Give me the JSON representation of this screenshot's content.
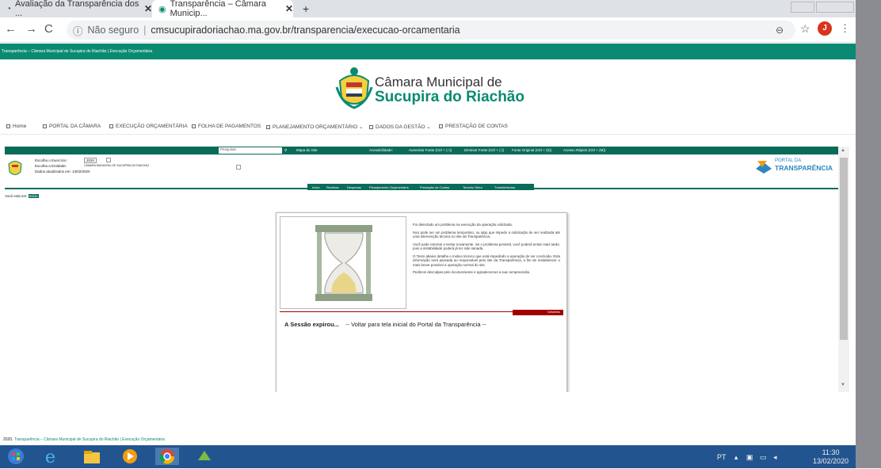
{
  "browser": {
    "tabs": [
      {
        "title": "Avaliação da Transparência dos ...",
        "close": "✕"
      },
      {
        "title": "Transparência – Câmara Municip...",
        "close": "✕"
      }
    ],
    "new_tab": "+",
    "security_label": "Não seguro",
    "url": "cmsucupiradoriachao.ma.gov.br/transparencia/execucao-orcamentaria",
    "profile_initial": "J"
  },
  "site": {
    "top_bar_text": "Transparência – Câmara Municipal de Sucupira do Riachão | Execução Orçamentária",
    "logo_line1": "Câmara Municipal de",
    "logo_line2": "Sucupira do Riachão",
    "nav": [
      "Home",
      "PORTAL DA CÂMARA",
      "EXECUÇÃO ORÇAMENTÁRIA",
      "FOLHA DE PAGAMENTOS",
      "PLANEJAMENTO ORÇAMENTÁRIO",
      "DADOS DA GESTÃO",
      "PRESTAÇÃO DE CONTAS"
    ]
  },
  "portal": {
    "search_placeholder": "Pesquisar",
    "site_map": "Mapa do Site",
    "accessibility_label": "Acessibilidade:",
    "access_items": [
      "Aumentar Fonte (Ctrl + (+))",
      "Diminuir Fonte (Ctrl + (-))",
      "Fonte Original (Ctrl + (0))",
      "Acesso Rápido (Ctrl + (M))"
    ],
    "exercise_label": "Escolha o Exercício:",
    "exercise_value": "2020",
    "entity_label": "Escolha a Entidade:",
    "entity_value": "CÂMARA MUNICIPAL DE SUCUPIRA DO RIACHAO",
    "updated_label": "Dados atualizados em: 13/02/2020",
    "portal_logo_1": "PORTAL DA",
    "portal_logo_2": "TRANSPARÊNCIA",
    "submenu": [
      "Início",
      "Receitas",
      "Despesas",
      "Planejamento Orçamentário",
      "Prestação de Contas",
      "Terceiro Setor",
      "Transferências"
    ],
    "breadcrumb_label": "Você está em:",
    "breadcrumb_home": "Início"
  },
  "error": {
    "p1": "Foi detectado um problema na execução da operação solicitada.",
    "p2": "Isso pode ser um problema temporário, ou algo que impede a solicitação de ser realizada até uma intervenção técnica no site da Transparência.",
    "p3": "Você pode retornar e tentar novamente. Se o problema persistir, você poderá tentar mais tarde, pois a instabilidade poderá já ter sido sanada.",
    "p4": "O Texto abaixo detalha o motivo técnico que está impedindo a operação de ser concluída. Esta informação será passada ao responsável pelo site da Transparência, a fim de restabelecer o mais breve possível a operação normal do site.",
    "p5": "Pedimos desculpas pelo inconveniente e agradecemos a sua compreensão.",
    "details": "Detalhes",
    "session_expired": "A Sessão expirou...",
    "back_link": "-- Voltar para tela inicial do Portal da Transparência --"
  },
  "footer": {
    "year": "2020.",
    "link": "Transparência – Câmara Municipal de Sucupira do Riachão | Execução Orçamentária"
  },
  "taskbar": {
    "lang": "PT",
    "time": "11:30",
    "date": "13/02/2020"
  },
  "colors": {
    "site_green": "#0a8a73",
    "portal_green": "#0a6b59",
    "error_red": "#a20000",
    "taskbar_blue": "#22558f"
  }
}
